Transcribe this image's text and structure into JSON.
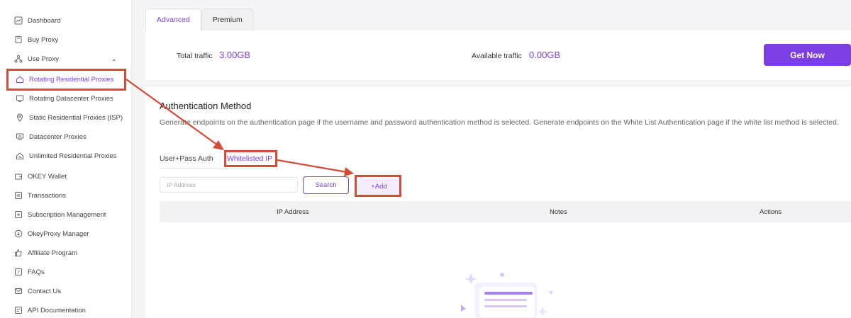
{
  "sidebar": {
    "items": [
      {
        "label": "Dashboard",
        "icon": "chart-icon"
      },
      {
        "label": "Buy Proxy",
        "icon": "cart-icon"
      },
      {
        "label": "Use Proxy",
        "icon": "network-icon"
      },
      {
        "label": "Rotating Residential Proxies",
        "icon": "home-icon"
      },
      {
        "label": "Rotating Datacenter Proxies",
        "icon": "monitor-icon"
      },
      {
        "label": "Static Residential Proxies (ISP)",
        "icon": "location-pin-icon"
      },
      {
        "label": "Datacenter Proxies",
        "icon": "server-icon"
      },
      {
        "label": "Unlimited Residential Proxies",
        "icon": "house-infinity-icon"
      },
      {
        "label": "OKEY Wallet",
        "icon": "wallet-icon"
      },
      {
        "label": "Transactions",
        "icon": "exchange-icon"
      },
      {
        "label": "Subscription Management",
        "icon": "subscription-icon"
      },
      {
        "label": "OkeyProxy Manager",
        "icon": "download-icon"
      },
      {
        "label": "Affiliate Program",
        "icon": "thumbs-up-icon"
      },
      {
        "label": "FAQs",
        "icon": "question-icon"
      },
      {
        "label": "Contact Us",
        "icon": "mail-icon"
      },
      {
        "label": "API Documentation",
        "icon": "api-icon"
      }
    ]
  },
  "tabs": [
    "Advanced",
    "Premium"
  ],
  "traffic": {
    "total_label": "Total traffic",
    "total_value": "3.00GB",
    "available_label": "Available traffic",
    "available_value": "0.00GB",
    "get_now": "Get Now"
  },
  "auth": {
    "title": "Authentication Method",
    "description": "Generate endpoints on the authentication page if the username and password authentication method is selected. Generate endpoints on the White List Authentication page if the white list method is selected.",
    "tab_userpass": "User+Pass Auth",
    "tab_whitelist": "Whitelisted IP",
    "ip_placeholder": "IP Address",
    "search": "Search",
    "add": "+Add",
    "columns": [
      "IP Address",
      "Notes",
      "Actions"
    ]
  },
  "colors": {
    "accent": "#7b3fe4",
    "annotation": "#d64b37"
  }
}
